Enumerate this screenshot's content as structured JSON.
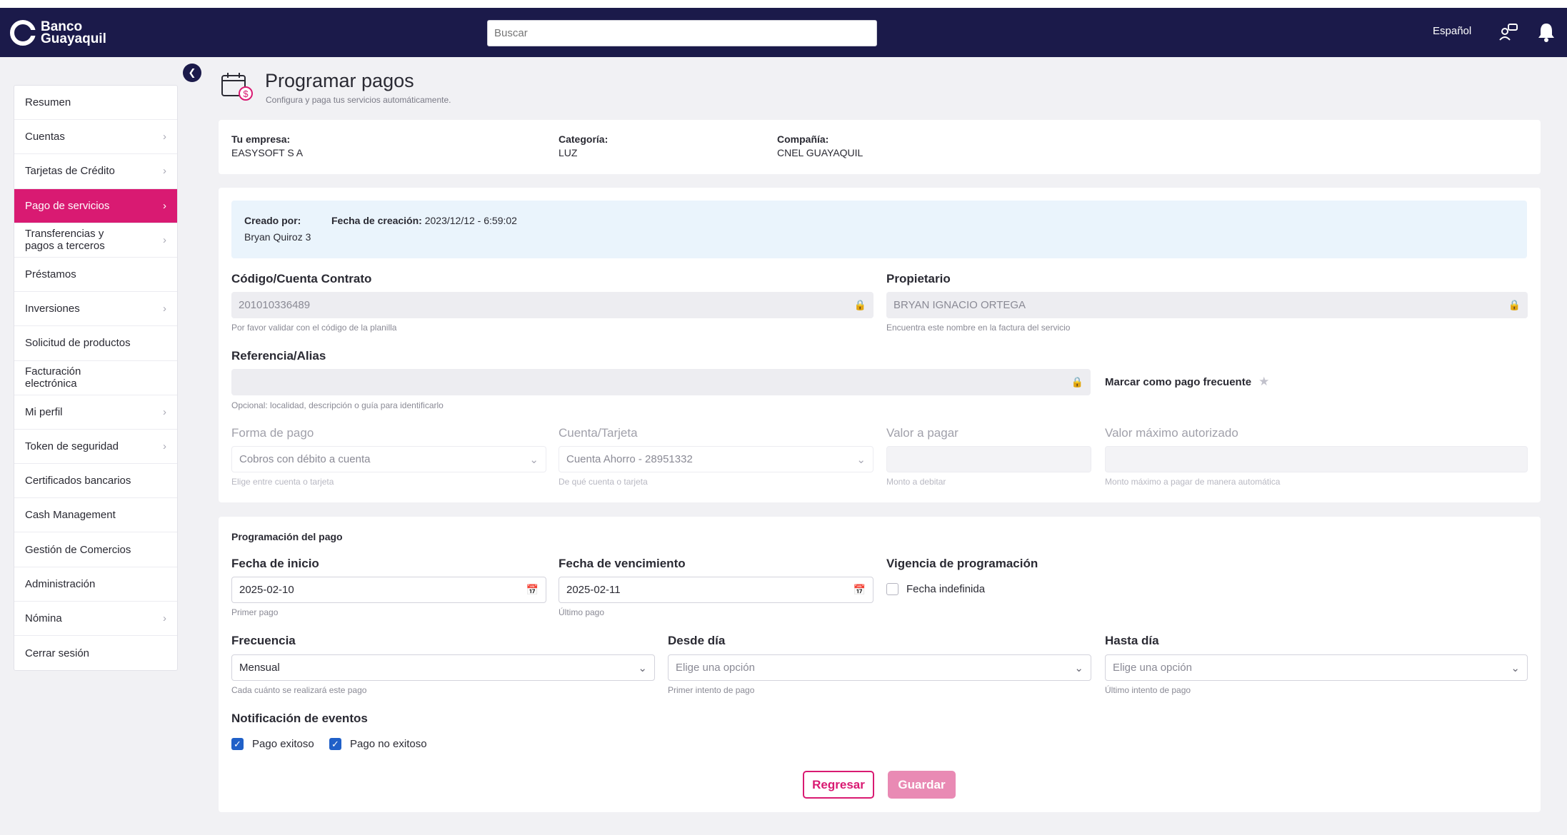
{
  "brand": {
    "name_line1": "Banco",
    "name_line2": "Guayaquil"
  },
  "header": {
    "search_placeholder": "Buscar",
    "language": "Español"
  },
  "sidebar": {
    "items": [
      {
        "label": "Resumen",
        "chevron": false,
        "active": false
      },
      {
        "label": "Cuentas",
        "chevron": true,
        "active": false
      },
      {
        "label": "Tarjetas de Crédito",
        "chevron": true,
        "active": false
      },
      {
        "label": "Pago de servicios",
        "chevron": true,
        "active": true
      },
      {
        "label": "Transferencias y pagos a terceros",
        "chevron": true,
        "active": false
      },
      {
        "label": "Préstamos",
        "chevron": false,
        "active": false
      },
      {
        "label": "Inversiones",
        "chevron": true,
        "active": false
      },
      {
        "label": "Solicitud de productos",
        "chevron": false,
        "active": false
      },
      {
        "label": "Facturación electrónica",
        "chevron": false,
        "active": false
      },
      {
        "label": "Mi perfil",
        "chevron": true,
        "active": false
      },
      {
        "label": "Token de seguridad",
        "chevron": true,
        "active": false
      },
      {
        "label": "Certificados bancarios",
        "chevron": false,
        "active": false
      },
      {
        "label": "Cash Management",
        "chevron": false,
        "active": false
      },
      {
        "label": "Gestión de Comercios",
        "chevron": false,
        "active": false
      },
      {
        "label": "Administración",
        "chevron": false,
        "active": false
      },
      {
        "label": "Nómina",
        "chevron": true,
        "active": false
      },
      {
        "label": "Cerrar sesión",
        "chevron": false,
        "active": false
      }
    ]
  },
  "page": {
    "title": "Programar pagos",
    "subtitle": "Configura y paga tus servicios automáticamente."
  },
  "summary": {
    "empresa_label": "Tu empresa:",
    "empresa_value": "EASYSOFT S A",
    "categoria_label": "Categoría:",
    "categoria_value": "LUZ",
    "compania_label": "Compañía:",
    "compania_value": "CNEL GUAYAQUIL"
  },
  "creation": {
    "creado_label": "Creado por:",
    "creado_value": "Bryan Quiroz 3",
    "fecha_label": "Fecha de creación:",
    "fecha_value": "2023/12/12 - 6:59:02"
  },
  "form": {
    "codigo_label": "Código/Cuenta Contrato",
    "codigo_value": "201010336489",
    "codigo_help": "Por favor validar con el código de la planilla",
    "propietario_label": "Propietario",
    "propietario_value": "BRYAN IGNACIO ORTEGA",
    "propietario_help": "Encuentra este nombre en la factura del servicio",
    "referencia_label": "Referencia/Alias",
    "referencia_value": "",
    "referencia_help": "Opcional: localidad, descripción o guía para identificarlo",
    "frecuente_label": "Marcar como pago frecuente",
    "forma_label": "Forma de pago",
    "forma_value": "Cobros con débito a cuenta",
    "forma_help": "Elige entre cuenta o tarjeta",
    "cuenta_label": "Cuenta/Tarjeta",
    "cuenta_value": "Cuenta Ahorro - 28951332",
    "cuenta_help": "De qué cuenta o tarjeta",
    "valor_label": "Valor a pagar",
    "valor_help": "Monto a debitar",
    "maximo_label": "Valor máximo autorizado",
    "maximo_help": "Monto máximo a pagar de manera automática"
  },
  "schedule": {
    "section_title": "Programación del pago",
    "inicio_label": "Fecha de inicio",
    "inicio_value": "2025-02-10",
    "inicio_help": "Primer pago",
    "venc_label": "Fecha de vencimiento",
    "venc_value": "2025-02-11",
    "venc_help": "Último pago",
    "vigencia_label": "Vigencia de programación",
    "indefinida_label": "Fecha indefinida",
    "indefinida_checked": false,
    "frecuencia_label": "Frecuencia",
    "frecuencia_value": "Mensual",
    "frecuencia_help": "Cada cuánto se realizará este pago",
    "desde_label": "Desde día",
    "desde_placeholder": "Elige una opción",
    "desde_help": "Primer intento de pago",
    "hasta_label": "Hasta día",
    "hasta_placeholder": "Elige una opción",
    "hasta_help": "Último intento de pago",
    "notif_label": "Notificación de eventos",
    "exitoso_label": "Pago exitoso",
    "exitoso_checked": true,
    "noexitoso_label": "Pago no exitoso",
    "noexitoso_checked": true
  },
  "actions": {
    "back_label": "Regresar",
    "save_label": "Guardar"
  },
  "colors": {
    "navy": "#1b1a4a",
    "brand_pink": "#d91a72",
    "save_disabled": "#e98ab4",
    "checkbox_blue": "#2060c8",
    "info_bg": "#eaf4fc"
  }
}
